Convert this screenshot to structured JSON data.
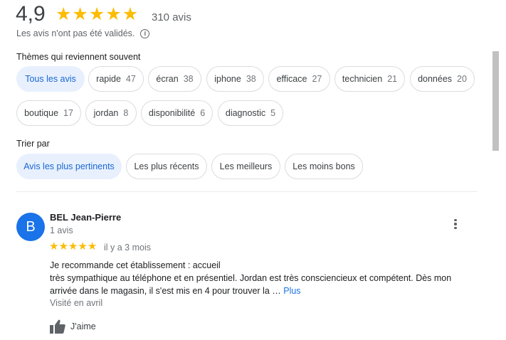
{
  "rating": {
    "value": "4,9",
    "stars": 5,
    "review_count": "310 avis",
    "disclaimer": "Les avis n'ont pas été validés.",
    "info_icon": "info-icon"
  },
  "themes": {
    "label": "Thèmes qui reviennent souvent",
    "chips": [
      {
        "label": "Tous les avis",
        "count": "",
        "selected": true
      },
      {
        "label": "rapide",
        "count": "47"
      },
      {
        "label": "écran",
        "count": "38"
      },
      {
        "label": "iphone",
        "count": "38"
      },
      {
        "label": "efficace",
        "count": "27"
      },
      {
        "label": "technicien",
        "count": "21"
      },
      {
        "label": "données",
        "count": "20"
      },
      {
        "label": "boutique",
        "count": "17"
      },
      {
        "label": "jordan",
        "count": "8"
      },
      {
        "label": "disponibilité",
        "count": "6"
      },
      {
        "label": "diagnostic",
        "count": "5"
      }
    ]
  },
  "sort": {
    "label": "Trier par",
    "options": [
      {
        "label": "Avis les plus pertinents",
        "selected": true
      },
      {
        "label": "Les plus récents"
      },
      {
        "label": "Les meilleurs"
      },
      {
        "label": "Les moins bons"
      }
    ]
  },
  "review": {
    "avatar_letter": "B",
    "avatar_color": "#1a73e8",
    "author": "BEL Jean-Pierre",
    "author_meta": "1 avis",
    "stars": 5,
    "time": "il y a 3 mois",
    "text_lines": [
      "Je recommande cet établissement : accueil",
      "très sympathique au téléphone et en présentiel. Jordan est très consciencieux et compétent. Dès mon",
      "arrivée dans le magasin, il s'est mis en 4 pour trouver la …"
    ],
    "more_label": "Plus",
    "visited": "Visité en avril",
    "like_label": "J'aime",
    "menu_icon": "more-vert-icon",
    "like_icon": "thumb-up-icon"
  },
  "colors": {
    "star": "#fbbc04",
    "accent": "#1a73e8",
    "chip_selected_bg": "#e8f0fe",
    "chip_selected_text": "#1967d2"
  }
}
